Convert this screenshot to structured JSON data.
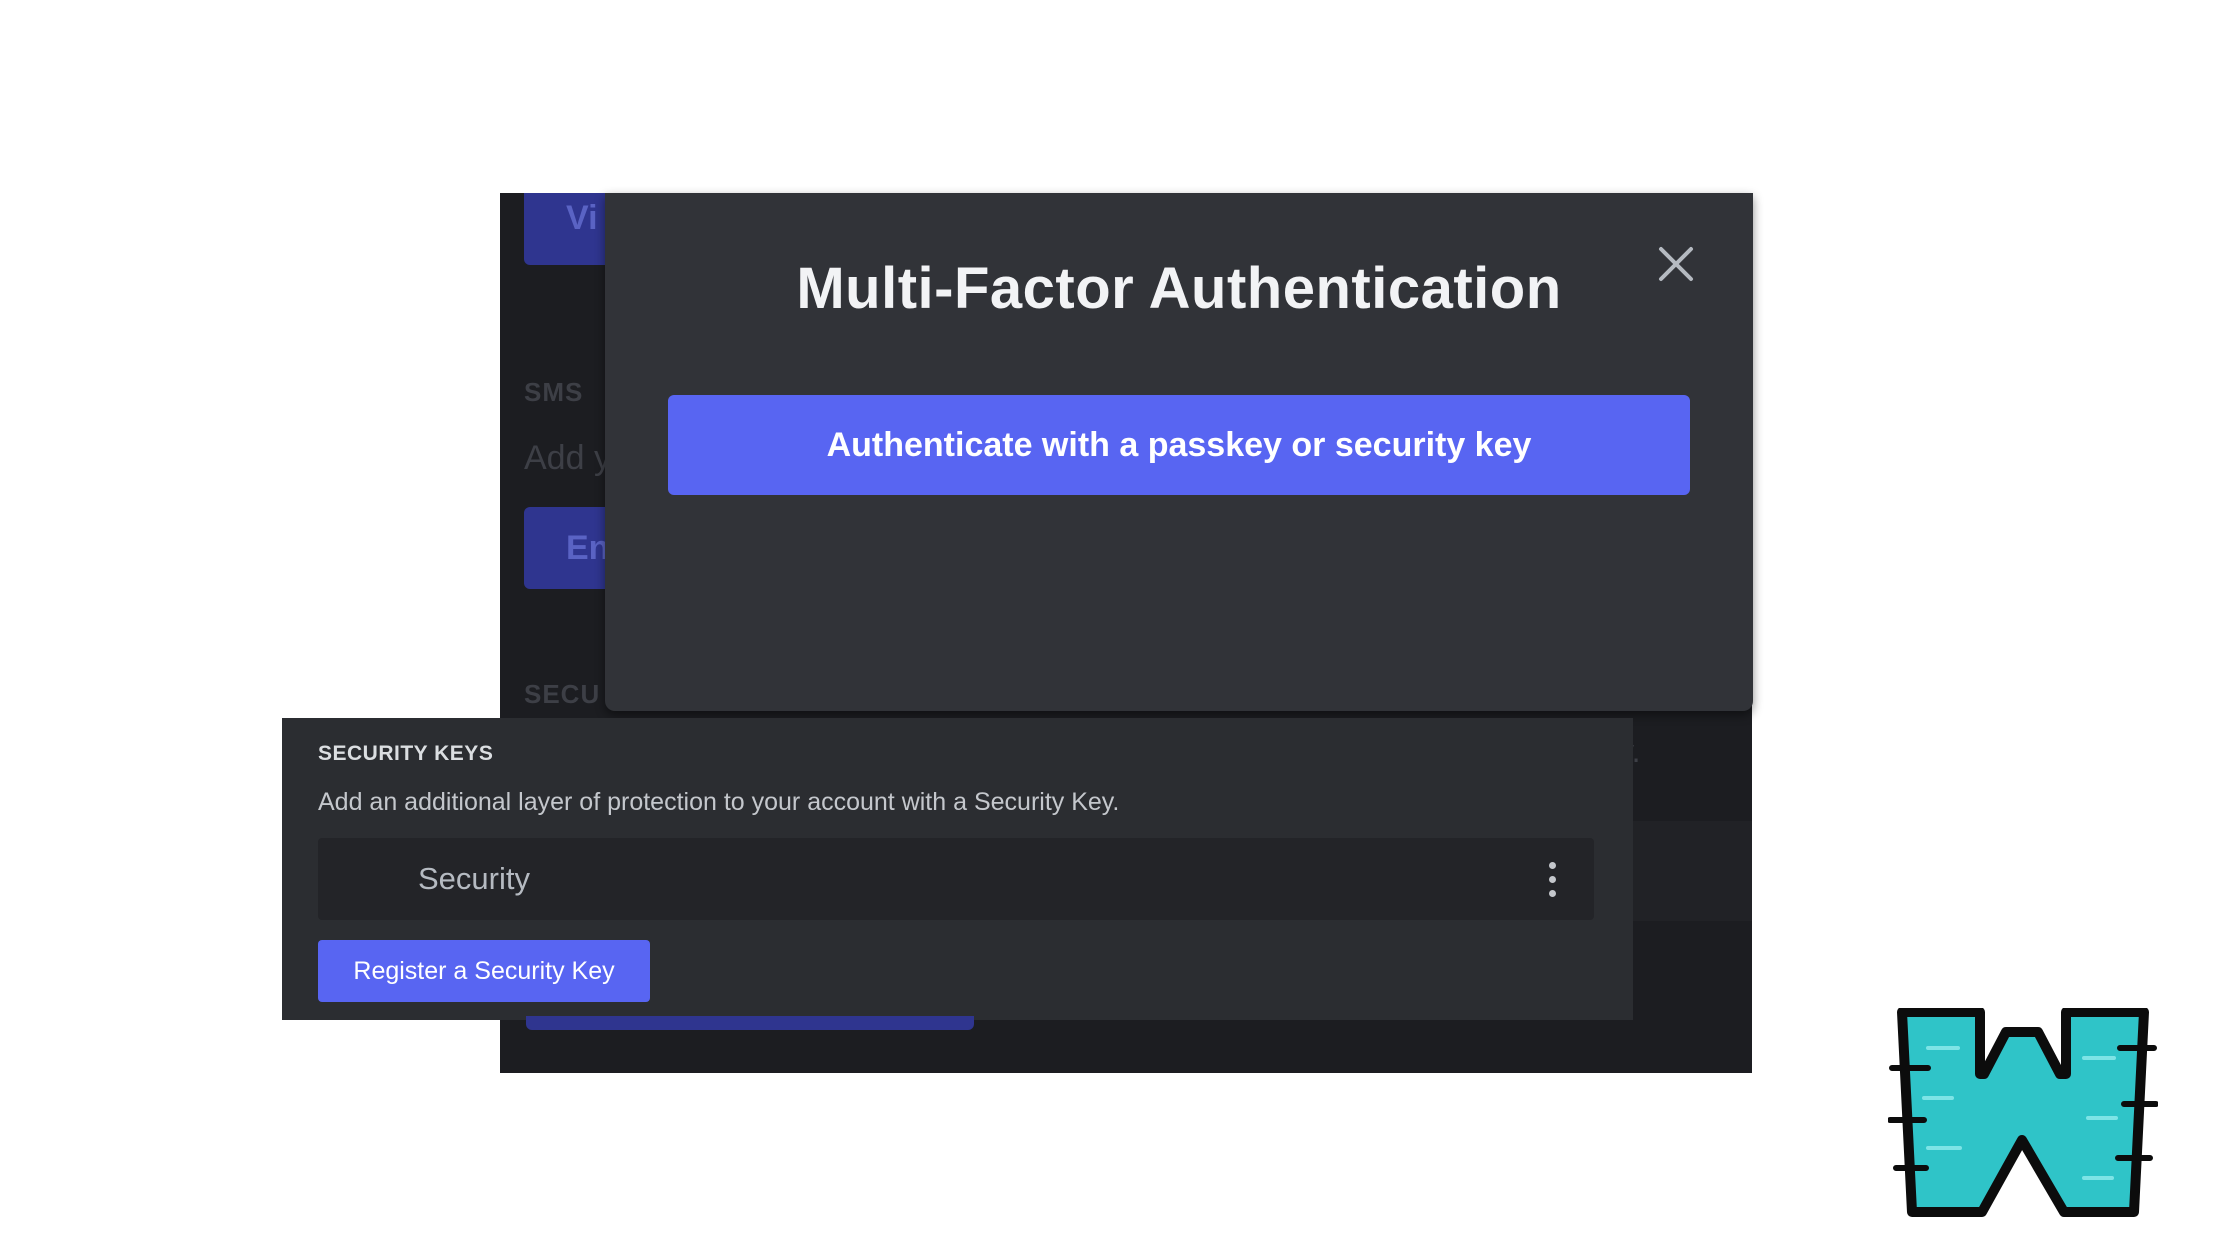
{
  "background_screen": {
    "button_top_fragment": "Vi",
    "sms_label_fragment": "SMS",
    "sms_text_fragment": "Add y",
    "button_mid_fragment": "En",
    "security_label_fragment": "SECU",
    "right_text_fragment": "y."
  },
  "modal": {
    "title": "Multi-Factor Authentication",
    "authenticate_button": "Authenticate with a passkey or security key",
    "close_icon": "close-icon"
  },
  "security_keys": {
    "heading": "SECURITY KEYS",
    "description": "Add an additional layer of protection to your account with a Security Key.",
    "key_name": "Security",
    "more_icon": "vertical-dots-icon",
    "register_button": "Register a Security Key"
  },
  "colors": {
    "accent": "#5865f2",
    "modal_bg": "#313338",
    "panel_bg": "#2b2d31",
    "logo_fill": "#2fc4c8"
  },
  "logo_icon": "w-logo-icon"
}
